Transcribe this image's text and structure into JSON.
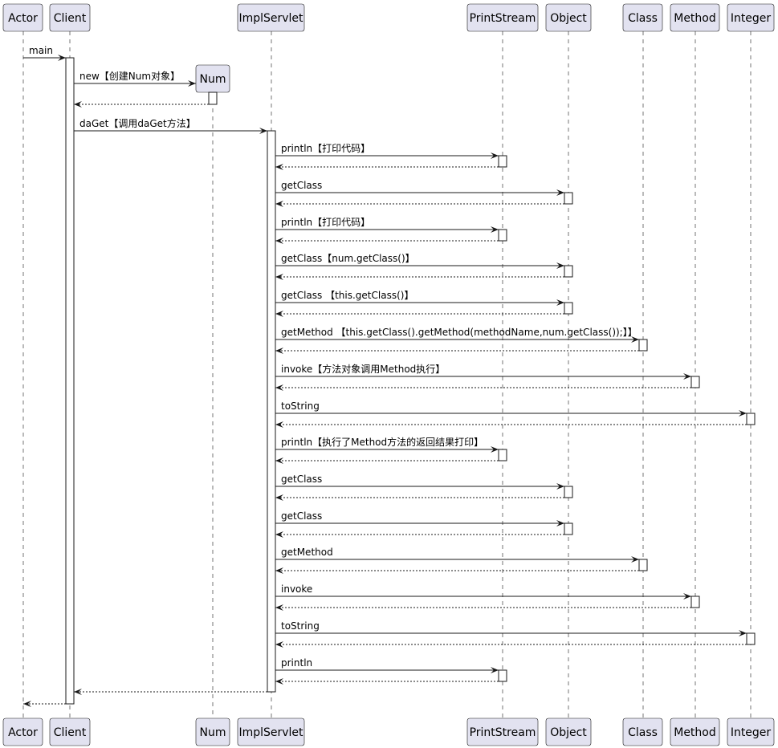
{
  "participants": [
    "Actor",
    "Client",
    "Num",
    "ImplServlet",
    "PrintStream",
    "Object",
    "Class",
    "Method",
    "Integer"
  ],
  "created_participant": "Num",
  "messages": [
    {
      "from": "Actor",
      "to": "Client",
      "label": "main"
    },
    {
      "from": "Client",
      "to": "Num",
      "label": "new【创建Num对象】",
      "create": true
    },
    {
      "from": "Client",
      "to": "ImplServlet",
      "label": "daGet【调用daGet方法】"
    },
    {
      "from": "ImplServlet",
      "to": "PrintStream",
      "label": "println【打印代码】"
    },
    {
      "from": "ImplServlet",
      "to": "Object",
      "label": "getClass"
    },
    {
      "from": "ImplServlet",
      "to": "PrintStream",
      "label": "println【打印代码】"
    },
    {
      "from": "ImplServlet",
      "to": "Object",
      "label": "getClass【num.getClass()】"
    },
    {
      "from": "ImplServlet",
      "to": "Object",
      "label": "getClass 【this.getClass()】"
    },
    {
      "from": "ImplServlet",
      "to": "Class",
      "label": "getMethod 【this.getClass().getMethod(methodName,num.getClass());】】"
    },
    {
      "from": "ImplServlet",
      "to": "Method",
      "label": "invoke【方法对象调用Method执行】"
    },
    {
      "from": "ImplServlet",
      "to": "Integer",
      "label": "toString"
    },
    {
      "from": "ImplServlet",
      "to": "PrintStream",
      "label": "println【执行了Method方法的返回结果打印】"
    },
    {
      "from": "ImplServlet",
      "to": "Object",
      "label": "getClass"
    },
    {
      "from": "ImplServlet",
      "to": "Object",
      "label": "getClass"
    },
    {
      "from": "ImplServlet",
      "to": "Class",
      "label": "getMethod"
    },
    {
      "from": "ImplServlet",
      "to": "Method",
      "label": "invoke"
    },
    {
      "from": "ImplServlet",
      "to": "Integer",
      "label": "toString"
    },
    {
      "from": "ImplServlet",
      "to": "PrintStream",
      "label": "println"
    }
  ],
  "colors": {
    "participant_fill": "#e2e2f0",
    "line": "#181818"
  }
}
